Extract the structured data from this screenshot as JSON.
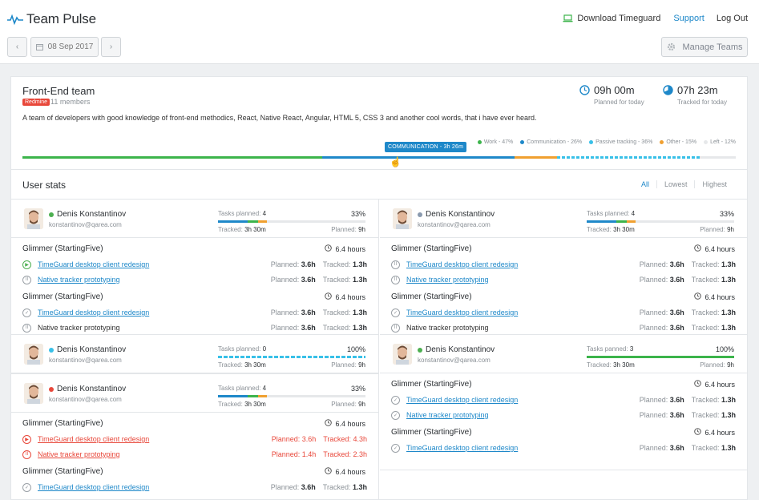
{
  "app": {
    "title": "Team Pulse"
  },
  "top_links": {
    "download": "Download Timeguard",
    "support": "Support",
    "logout": "Log Out"
  },
  "nav": {
    "prev": "‹",
    "date": "08 Sep 2017",
    "next": "›",
    "manage": "Manage Teams"
  },
  "team": {
    "name": "Front-End team",
    "badge": "Redmine",
    "members": "11 members",
    "description": "A team of developers with good knowledge of front-end methodics, React, Native React, Angular, HTML 5, CSS 3 and another cool words, that i have ever heard.",
    "planned": {
      "value": "09h 00m",
      "label": "Planned for today"
    },
    "tracked": {
      "value": "07h 23m",
      "label": "Tracked for today"
    },
    "legend": [
      {
        "label": "Work - 47%",
        "color": "#3cb44b"
      },
      {
        "label": "Communication - 26%",
        "color": "#1e88c9"
      },
      {
        "label": "Passive tracking - 36%",
        "color": "#38c0e8"
      },
      {
        "label": "Other - 15%",
        "color": "#f0a030"
      },
      {
        "label": "Left - 12%",
        "color": "#e6e8ea"
      }
    ],
    "tooltip": "COMMUNICATION - 3h 26m",
    "bar": [
      {
        "name": "work",
        "frac": 0.42,
        "color": "#3cb44b"
      },
      {
        "name": "communication",
        "frac": 0.27,
        "color": "#1e88c9"
      },
      {
        "name": "other",
        "frac": 0.06,
        "color": "#f0a030"
      },
      {
        "name": "passive",
        "frac": 0.2,
        "color": "#38c0e8"
      },
      {
        "name": "left",
        "frac": 0.05,
        "color": "#e6e8ea"
      }
    ]
  },
  "stats": {
    "title": "User stats",
    "filters": [
      "All",
      "Lowest",
      "Highest"
    ]
  },
  "users": [
    {
      "name": "Denis Konstantinov",
      "email": "konstantinov@qarea.com",
      "status_color": "#4caf50",
      "tasks_label": "Tasks planned:",
      "tasks": "4",
      "pct": "33%",
      "tracked_label": "Tracked:",
      "tracked": "3h 30m",
      "planned_label": "Planned:",
      "planned": "9h",
      "projects": [
        {
          "title": "Glimmer (StartingFive)",
          "hours": "6.4 hours",
          "tasks": [
            {
              "name": "TimeGuard desktop client redesign",
              "planned": "3.6h",
              "tracked": "1.3h",
              "icon": "▶",
              "style": "green",
              "link": true
            },
            {
              "name": "Native tracker prototyping",
              "planned": "3.6h",
              "tracked": "1.3h",
              "icon": "II",
              "style": "",
              "link": true
            }
          ]
        },
        {
          "title": "Glimmer (StartingFive)",
          "hours": "6.4 hours",
          "tasks": [
            {
              "name": "TimeGuard desktop client redesign",
              "planned": "3.6h",
              "tracked": "1.3h",
              "icon": "✓",
              "style": "",
              "link": true
            },
            {
              "name": "Native tracker prototyping",
              "planned": "3.6h",
              "tracked": "1.3h",
              "icon": "II",
              "style": "",
              "link": false
            }
          ]
        }
      ]
    },
    {
      "name": "Denis Konstantinov",
      "email": "konstantinov@qarea.com",
      "status_color": "#8a9aae",
      "tasks_label": "Tasks planned:",
      "tasks": "4",
      "pct": "33%",
      "tracked_label": "Tracked:",
      "tracked": "3h 30m",
      "planned_label": "Planned:",
      "planned": "9h",
      "projects": [
        {
          "title": "Glimmer (StartingFive)",
          "hours": "6.4 hours",
          "tasks": [
            {
              "name": "TimeGuard desktop client redesign",
              "planned": "3.6h",
              "tracked": "1.3h",
              "icon": "II",
              "style": "",
              "link": true
            },
            {
              "name": "Native tracker prototyping",
              "planned": "3.6h",
              "tracked": "1.3h",
              "icon": "II",
              "style": "",
              "link": true
            }
          ]
        },
        {
          "title": "Glimmer (StartingFive)",
          "hours": "6.4 hours",
          "tasks": [
            {
              "name": "TimeGuard desktop client redesign",
              "planned": "3.6h",
              "tracked": "1.3h",
              "icon": "✓",
              "style": "",
              "link": true
            },
            {
              "name": "Native tracker prototyping",
              "planned": "3.6h",
              "tracked": "1.3h",
              "icon": "II",
              "style": "",
              "link": false
            }
          ]
        }
      ]
    },
    {
      "name": "Denis Konstantinov",
      "email": "konstantinov@qarea.com",
      "status_color": "#38c0e8",
      "tasks_label": "Tasks planned:",
      "tasks": "0",
      "pct": "100%",
      "tracked_label": "Tracked:",
      "tracked": "3h 30m",
      "planned_label": "Planned:",
      "planned": "9h"
    },
    {
      "name": "Denis Konstantinov",
      "email": "konstantinov@qarea.com",
      "status_color": "#4caf50",
      "tasks_label": "Tasks panned:",
      "tasks": "3",
      "pct": "100%",
      "tracked_label": "Tracked:",
      "tracked": "3h 30m",
      "planned_label": "Planned:",
      "planned": "9h",
      "projects": [
        {
          "title": "Glimmer (StartingFive)",
          "hours": "6.4 hours",
          "tasks": [
            {
              "name": "TimeGuard desktop client redesign",
              "planned": "3.6h",
              "tracked": "1.3h",
              "icon": "✓",
              "style": "",
              "link": true
            },
            {
              "name": "Native tracker prototyping",
              "planned": "3.6h",
              "tracked": "1.3h",
              "icon": "✓",
              "style": "",
              "link": true
            }
          ]
        },
        {
          "title": "Glimmer (StartingFive)",
          "hours": "6.4 hours",
          "tasks": [
            {
              "name": "TimeGuard desktop client redesign",
              "planned": "3.6h",
              "tracked": "1.3h",
              "icon": "✓",
              "style": "",
              "link": true
            }
          ]
        }
      ]
    },
    {
      "name": "Denis Konstantinov",
      "email": "konstantinov@qarea.com",
      "status_color": "#e8473a",
      "tasks_label": "Tasks planned:",
      "tasks": "4",
      "pct": "33%",
      "tracked_label": "Tracked:",
      "tracked": "3h 30m",
      "planned_label": "Planned:",
      "planned": "9h",
      "projects": [
        {
          "title": "Glimmer (StartingFive)",
          "hours": "6.4 hours",
          "tasks": [
            {
              "name": "TimeGuard desktop client redesign",
              "planned": "3.6h",
              "tracked": "4.3h",
              "icon": "▶",
              "style": "red",
              "link": true
            },
            {
              "name": "Native tracker prototyping",
              "planned": "1.4h",
              "tracked": "2.3h",
              "icon": "II",
              "style": "red",
              "link": true
            }
          ]
        },
        {
          "title": "Glimmer (StartingFive)",
          "hours": "6.4 hours",
          "tasks": [
            {
              "name": "TimeGuard desktop client redesign",
              "planned": "3.6h",
              "tracked": "1.3h",
              "icon": "✓",
              "style": "",
              "link": true
            }
          ]
        }
      ]
    }
  ],
  "labels": {
    "planned": "Planned:",
    "tracked": "Tracked:"
  }
}
